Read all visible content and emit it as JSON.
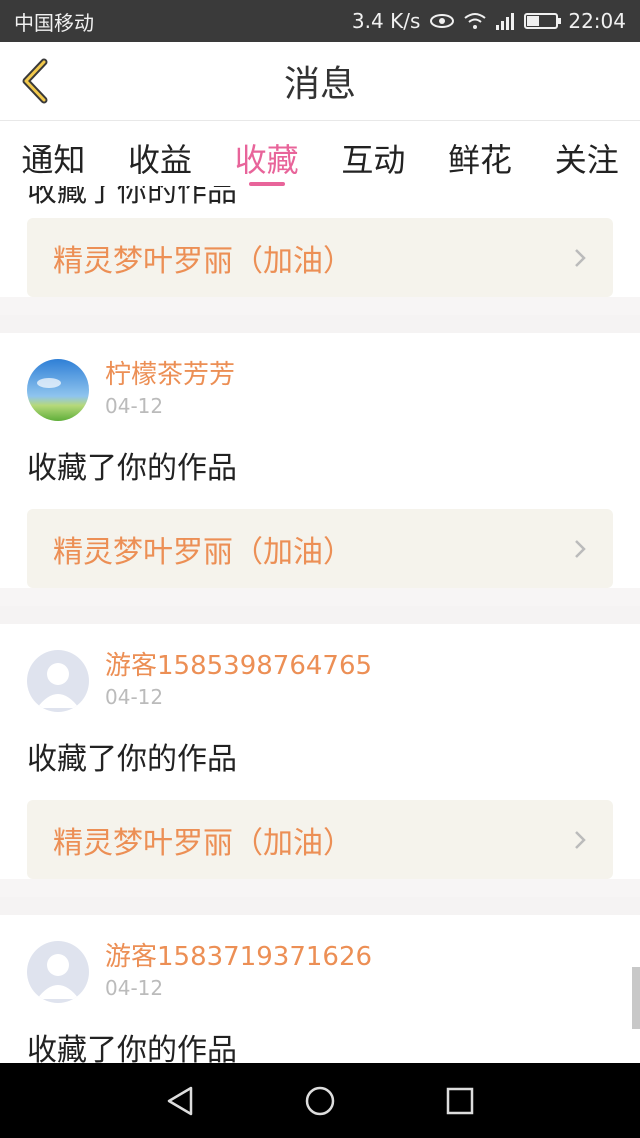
{
  "status_bar": {
    "carrier": "中国移动",
    "speed": "3.4 K/s",
    "network": "4G",
    "time": "22:04"
  },
  "header": {
    "title": "消息"
  },
  "tabs": [
    {
      "label": "通知",
      "active": false
    },
    {
      "label": "收益",
      "active": false
    },
    {
      "label": "收藏",
      "active": true
    },
    {
      "label": "互动",
      "active": false
    },
    {
      "label": "鲜花",
      "active": false
    },
    {
      "label": "关注",
      "active": false
    }
  ],
  "items": [
    {
      "partial": true,
      "action": "收藏了你的作品",
      "work_title": "精灵梦叶罗丽（加油）"
    },
    {
      "user": "柠檬茶芳芳",
      "date": "04-12",
      "avatar": "sky-avatar",
      "action": "收藏了你的作品",
      "work_title": "精灵梦叶罗丽（加油）"
    },
    {
      "user": "游客1585398764765",
      "date": "04-12",
      "avatar": "default-avatar",
      "action": "收藏了你的作品",
      "work_title": "精灵梦叶罗丽（加油）"
    },
    {
      "user": "游客1583719371626",
      "date": "04-12",
      "avatar": "default-avatar",
      "action": "收藏了你的作品"
    }
  ],
  "colors": {
    "accent": "#e8649a",
    "username": "#ec8f55",
    "work_bg": "#f5f3ec"
  }
}
